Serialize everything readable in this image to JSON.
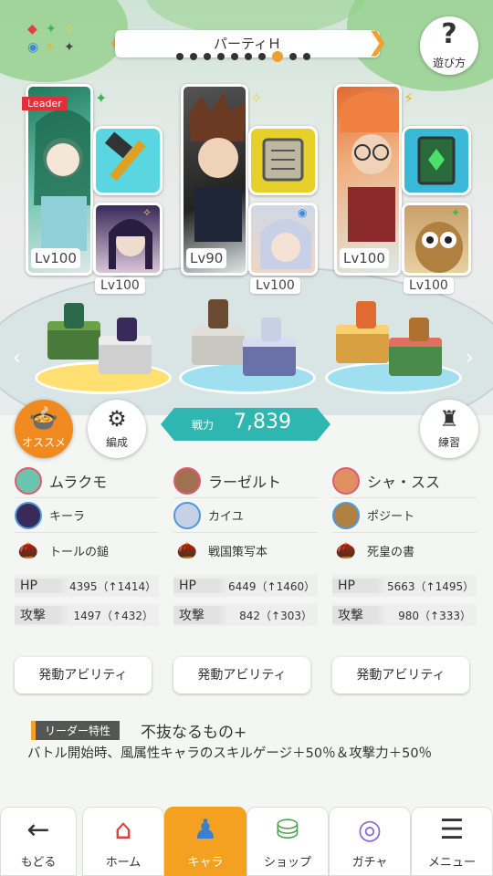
{
  "header": {
    "party_name": "パーティＨ",
    "help_label": "遊び方",
    "page_dots": 10,
    "active_dot": 8
  },
  "cards": [
    {
      "leader_tag": "Leader",
      "main_level": "Lv100",
      "sub_level": "Lv100",
      "element_color": "#3bb84a"
    },
    {
      "leader_tag": "",
      "main_level": "Lv90",
      "sub_level": "Lv100",
      "element_color": "#e8d44a"
    },
    {
      "leader_tag": "",
      "main_level": "Lv100",
      "sub_level": "Lv100",
      "element_color": "#f0b020"
    }
  ],
  "buttons": {
    "osusume": "オススメ",
    "hensei": "編成",
    "renshu": "練習"
  },
  "power": {
    "label": "戦力",
    "value": "7,839"
  },
  "columns": [
    {
      "main_name": "ムラクモ",
      "sub_name": "キーラ",
      "item": "トールの鎚",
      "hp_label": "HP",
      "hp": "4395（↑1414）",
      "atk_label": "攻撃",
      "atk": "1497（↑432）",
      "ability": "発動アビリティ"
    },
    {
      "main_name": "ラーゼルト",
      "sub_name": "カイユ",
      "item": "戦国策写本",
      "hp_label": "HP",
      "hp": "6449（↑1460）",
      "atk_label": "攻撃",
      "atk": "842（↑303）",
      "ability": "発動アビリティ"
    },
    {
      "main_name": "シャ・スス",
      "sub_name": "ポジート",
      "item": "死皇の書",
      "hp_label": "HP",
      "hp": "5663（↑1495）",
      "atk_label": "攻撃",
      "atk": "980（↑333）",
      "ability": "発動アビリティ"
    }
  ],
  "leader": {
    "label": "リーダー特性",
    "name": "不抜なるもの+",
    "description": "バトル開始時、風属性キャラのスキルゲージ＋50％＆攻撃力＋50％"
  },
  "nav": [
    {
      "label": "もどる",
      "icon": "back-arrow-icon"
    },
    {
      "label": "ホーム",
      "icon": "home-icon"
    },
    {
      "label": "キャラ",
      "icon": "character-icon"
    },
    {
      "label": "ショップ",
      "icon": "shop-icon"
    },
    {
      "label": "ガチャ",
      "icon": "gacha-icon"
    },
    {
      "label": "メニュー",
      "icon": "menu-icon"
    }
  ],
  "colors": {
    "accent": "#f4a020",
    "power": "#2fb6b0",
    "leader_tag": "#e0303a"
  }
}
